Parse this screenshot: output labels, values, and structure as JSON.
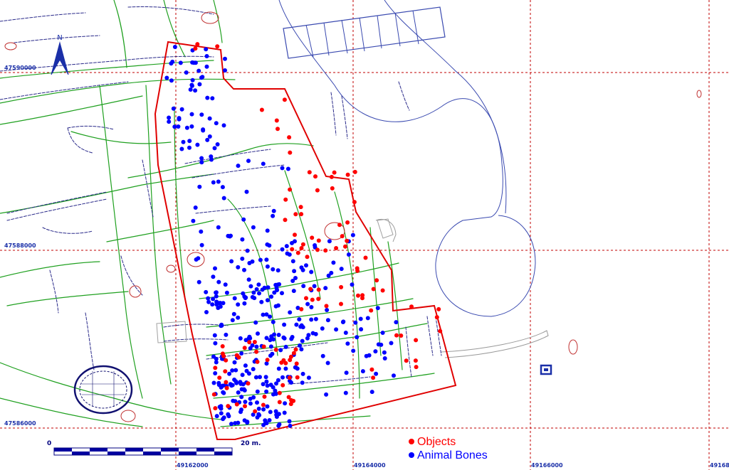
{
  "map": {
    "north_label": "N",
    "grid_labels": {
      "y": [
        "47590000",
        "47588000",
        "47586000"
      ],
      "x": [
        "49162000",
        "49164000",
        "49166000",
        "49168"
      ]
    },
    "scale_bar": {
      "start_label": "0",
      "end_label": "20 m."
    },
    "legend": {
      "objects_label": "Objects",
      "bones_label": "Animal Bones",
      "objects_color": "#ff0000",
      "bones_color": "#0000ff"
    },
    "colors": {
      "excavation_boundary": "#e00000",
      "grid": "#c00000",
      "features_green": "#1fa01f",
      "features_outline": "#2a2a8a",
      "survey_outline": "#3a4ab0"
    }
  }
}
